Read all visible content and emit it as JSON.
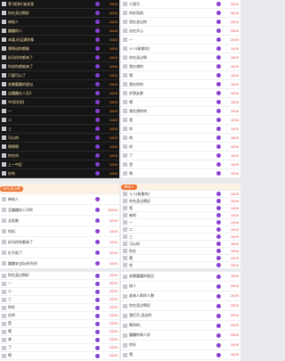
{
  "p1": {
    "rows": [
      {
        "t": "",
        "l": "等{昵称}被发现",
        "v": "2000"
      },
      {
        "t": "",
        "l": "你在身边啊好",
        "v": "4000"
      },
      {
        "t": "",
        "l": "神秘人",
        "v": "2000"
      },
      {
        "t": "",
        "l": "蹦蹦的人",
        "v": "2000"
      },
      {
        "t": "",
        "l": "恭喜,好运通你都",
        "v": "1000"
      },
      {
        "t": "",
        "l": "嗯啊送你都能",
        "v": "1000"
      },
      {
        "t": "",
        "l": "好风伴你都来了",
        "v": "1000"
      },
      {
        "t": "",
        "l": "你说你都能来了",
        "v": "1000"
      },
      {
        "t": "",
        "l": "只要可以了",
        "v": "1000"
      },
      {
        "t": "",
        "l": "安静圆圆的星出",
        "v": "1000"
      },
      {
        "t": "",
        "l": "这蹦蹦在人员1",
        "v": "1000"
      },
      {
        "t": "",
        "l": "中(如)(如)",
        "v": "1000"
      },
      {
        "t": "",
        "l": "一",
        "v": "1000"
      },
      {
        "t": "",
        "l": "二",
        "v": "1000"
      },
      {
        "t": "",
        "l": "三",
        "v": "1000"
      },
      {
        "t": "",
        "l": "可以的",
        "v": "1000"
      },
      {
        "t": "",
        "l": "啊啊啊",
        "v": "1000"
      },
      {
        "t": "",
        "l": "你在吗",
        "v": "1000"
      },
      {
        "t": "",
        "l": "上一中区",
        "v": "1000"
      },
      {
        "t": "",
        "l": "好的",
        "v": "1000"
      }
    ]
  },
  "p2": {
    "rows": [
      {
        "t": "",
        "l": "小我不,",
        "v": "2000"
      },
      {
        "t": "",
        "l": "你好再再",
        "v": "3000"
      },
      {
        "t": "",
        "l": "您在身边你",
        "v": "2000"
      },
      {
        "t": "",
        "l": "自在开心",
        "v": "2000"
      },
      {
        "t": "",
        "l": "一",
        "v": "2000"
      },
      {
        "t": "",
        "l": "十八(粉紫的)",
        "v": "1000"
      },
      {
        "t": "",
        "l": "你在身边啊",
        "v": "1000"
      },
      {
        "t": "",
        "l": "我在想你",
        "v": "1000"
      },
      {
        "t": "",
        "l": "嗯",
        "v": "1000"
      },
      {
        "t": "",
        "l": "我在你的",
        "v": "1000"
      },
      {
        "t": "",
        "l": "好朋友都",
        "v": "1000"
      },
      {
        "t": "",
        "l": "嗯",
        "v": "1000"
      },
      {
        "t": "",
        "l": "我在想你的",
        "v": "1000"
      },
      {
        "t": "",
        "l": "我",
        "v": "1000"
      },
      {
        "t": "",
        "l": "你",
        "v": "1000"
      },
      {
        "t": "",
        "l": "他",
        "v": "1000"
      },
      {
        "t": "",
        "l": "的",
        "v": "1000"
      },
      {
        "t": "",
        "l": "了",
        "v": "1000"
      },
      {
        "t": "",
        "l": "是",
        "v": "1000"
      },
      {
        "t": "",
        "l": "啊",
        "v": "1000"
      }
    ]
  },
  "p3": {
    "header": "你在身边啊",
    "rows": [
      {
        "t": "",
        "l": "神秘人",
        "v": "",
        "d": ""
      },
      {
        "t": "",
        "l": "至蹦蹦的人199",
        "v": "",
        "d": "20000"
      },
      {
        "t": "",
        "l": "全家都",
        "v": "",
        "d": "2000"
      },
      {
        "t": "",
        "l": "你好,",
        "v": "",
        "d": "1000"
      },
      {
        "t": "",
        "l": "好风伴你都来了",
        "v": "",
        "d": "1000"
      },
      {
        "t": "",
        "l": "红不起了",
        "v": "",
        "d": "1000"
      },
      {
        "t": "",
        "l": "蹦蹦安全by时光时",
        "v": "",
        "d": "1000"
      }
    ]
  },
  "p4": {
    "header": "神秘人",
    "rows": [
      {
        "t": "",
        "l": "十八(粉紫的)",
        "v": "1000"
      },
      {
        "t": "",
        "l": "你在身边啊好",
        "v": "1000"
      },
      {
        "t": "",
        "l": "等",
        "v": "1000"
      },
      {
        "t": "",
        "l": "新的",
        "v": "1000"
      },
      {
        "t": "",
        "l": "一",
        "v": "1000"
      },
      {
        "t": "",
        "l": "二",
        "v": "1000"
      },
      {
        "t": "",
        "l": "三",
        "v": "1000"
      },
      {
        "t": "",
        "l": "可以的",
        "v": "1000"
      },
      {
        "t": "",
        "l": "你在",
        "v": "1000"
      },
      {
        "t": "",
        "l": "嗯",
        "v": "1000"
      },
      {
        "t": "",
        "l": "的",
        "v": "1000"
      }
    ]
  },
  "p5": {
    "rows": [
      {
        "t": "",
        "l": "你在身边啊好",
        "v": "2000"
      },
      {
        "t": "",
        "l": "一",
        "v": "3000"
      },
      {
        "t": "",
        "l": "二",
        "v": "1000"
      },
      {
        "t": "",
        "l": "三",
        "v": "1000"
      },
      {
        "t": "",
        "l": "你好",
        "v": "1000"
      },
      {
        "t": "",
        "l": "在的",
        "v": "1000"
      },
      {
        "t": "",
        "l": "是",
        "v": "1000"
      },
      {
        "t": "",
        "l": "嗯",
        "v": "1000"
      },
      {
        "t": "",
        "l": "来",
        "v": "1000"
      },
      {
        "t": "",
        "l": "了",
        "v": "1000"
      },
      {
        "t": "",
        "l": "啊",
        "v": "1000"
      }
    ]
  },
  "p6": {
    "rows": [
      {
        "t": "",
        "l": "安静圆圆的星出",
        "v": "1000"
      },
      {
        "t": "",
        "l": "秘人",
        "v": "2000"
      },
      {
        "t": "",
        "l": "谁来人帮你人数",
        "v": "2000"
      },
      {
        "t": "",
        "l": "你在身边啊好",
        "v": "2000"
      },
      {
        "t": "",
        "l": "我们不,身边的",
        "v": "2000"
      },
      {
        "t": "",
        "l": "瞬间的,",
        "v": "2000"
      },
      {
        "t": "",
        "l": "蹦蹦你和人好",
        "v": "2000"
      },
      {
        "t": "",
        "l": "你好",
        "v": "2000"
      },
      {
        "t": "",
        "l": "嗯",
        "v": "1000"
      }
    ]
  }
}
